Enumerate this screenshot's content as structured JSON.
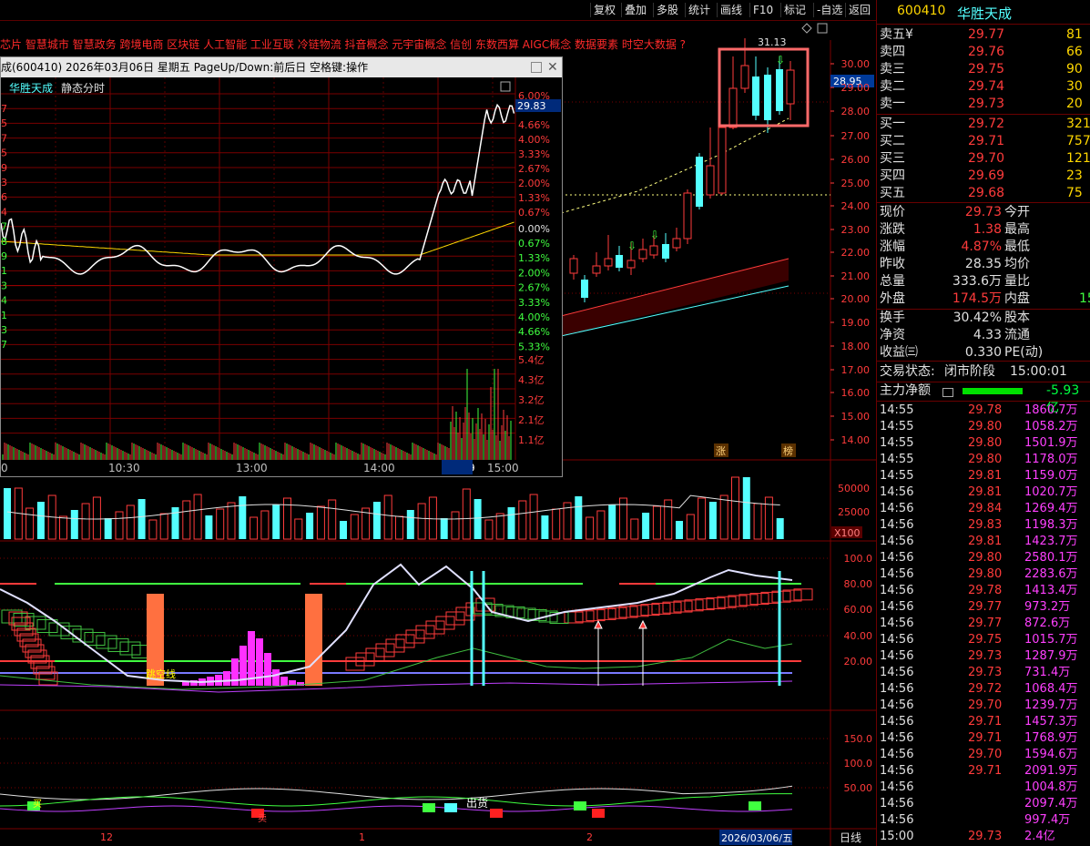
{
  "toolbar": {
    "buttons": [
      "复权",
      "叠加",
      "多股",
      "统计",
      "画线",
      "F10",
      "标记",
      "-自选",
      "返回"
    ]
  },
  "concepts_text": "芯片 智慧城市 智慧政务 跨境电商 区块链 人工智能 工业互联 冷链物流 抖音概念 元宇宙概念 信创 东数西算 AIGC概念 数据要素 时空大数据 ?",
  "main_chart": {
    "price_axis": [
      "30.00",
      "29.00",
      "28.00",
      "27.00",
      "26.00",
      "25.00",
      "24.00",
      "23.00",
      "22.00",
      "21.00",
      "20.00",
      "19.00",
      "18.00",
      "17.00",
      "16.00",
      "15.00",
      "14.00"
    ],
    "current_price_tag": "28.95",
    "high_label": "31.13",
    "zhang_label": "涨",
    "bang_label": "榜",
    "vol_axis": [
      "50000",
      "25000"
    ],
    "vol_unit": "X100",
    "kdj_axis": [
      "100.0",
      "80.00",
      "60.00",
      "40.00",
      "20.00"
    ],
    "bottom_axis": [
      "150.0",
      "100.0",
      "50.00"
    ],
    "x_labels": [
      "12",
      "1",
      "2"
    ],
    "date_label": "2026/03/06/五",
    "period_label": "日线",
    "annot_tiaoxian": "跳空线",
    "annot_chuhuo": "出货",
    "annot_mai": "买",
    "annot_mai2": "卖"
  },
  "popup": {
    "title": "成(600410) 2026年03月06日 星期五 PageUp/Down:前后日 空格键:操作",
    "stock_name": "华胜天成",
    "mode": "静态分时",
    "price_tag": "29.83",
    "pct_up": [
      "6.00%",
      "4.66%",
      "4.00%",
      "3.33%",
      "2.67%",
      "2.00%",
      "1.33%",
      "0.67%",
      "0.00%"
    ],
    "pct_down": [
      "0.67%",
      "1.33%",
      "2.00%",
      "2.67%",
      "3.33%",
      "4.00%",
      "4.66%",
      "5.33%"
    ],
    "vol_axis": [
      "5.4亿",
      "4.3亿",
      "3.2亿",
      "2.1亿",
      "1.1亿"
    ],
    "time_axis": [
      "0",
      "10:30",
      "13:00",
      "14:00",
      "14:39",
      "15:00"
    ],
    "left_digits": [
      "7",
      "5",
      "7",
      "5",
      "9",
      "3",
      "6",
      "4",
      "7",
      "8",
      "9",
      "1",
      "3",
      "4",
      "1",
      "3",
      "7"
    ]
  },
  "quote": {
    "code": "600410",
    "name": "华胜天成",
    "sell": [
      {
        "label": "卖五¥",
        "price": "29.77",
        "vol": "81"
      },
      {
        "label": "卖四",
        "price": "29.76",
        "vol": "66"
      },
      {
        "label": "卖三",
        "price": "29.75",
        "vol": "90"
      },
      {
        "label": "卖二",
        "price": "29.74",
        "vol": "30"
      },
      {
        "label": "卖一",
        "price": "29.73",
        "vol": "20"
      }
    ],
    "buy": [
      {
        "label": "买一",
        "price": "29.72",
        "vol": "321"
      },
      {
        "label": "买二",
        "price": "29.71",
        "vol": "757"
      },
      {
        "label": "买三",
        "price": "29.70",
        "vol": "121"
      },
      {
        "label": "买四",
        "price": "29.69",
        "vol": "23"
      },
      {
        "label": "买五",
        "price": "29.68",
        "vol": "75"
      }
    ],
    "stats": [
      {
        "l1": "现价",
        "v1": "29.73",
        "l2": "今开"
      },
      {
        "l1": "涨跌",
        "v1": "1.38",
        "l2": "最高"
      },
      {
        "l1": "涨幅",
        "v1": "4.87%",
        "l2": "最低"
      },
      {
        "l1": "昨收",
        "v1": "28.35",
        "l2": "均价"
      },
      {
        "l1": "总量",
        "v1": "333.6万",
        "l2": "量比"
      },
      {
        "l1": "外盘",
        "v1": "174.5万",
        "l2": "内盘",
        "v2": "15"
      }
    ],
    "stats2": [
      {
        "l1": "换手",
        "v1": "30.42%",
        "l2": "股本"
      },
      {
        "l1": "净资",
        "v1": "4.33",
        "l2": "流通"
      },
      {
        "l1": "收益㈢",
        "v1": "0.330",
        "l2": "PE(动)"
      }
    ],
    "trade_state_label": "交易状态:",
    "trade_state": "闭市阶段",
    "trade_time": "15:00:01",
    "main_net_label": "主力净额",
    "main_net_value": "-5.93亿"
  },
  "ticks": [
    {
      "t": "14:55",
      "p": "29.78",
      "v": "1860.7万"
    },
    {
      "t": "14:55",
      "p": "29.80",
      "v": "1058.2万"
    },
    {
      "t": "14:55",
      "p": "29.80",
      "v": "1501.9万"
    },
    {
      "t": "14:55",
      "p": "29.80",
      "v": "1178.0万"
    },
    {
      "t": "14:55",
      "p": "29.81",
      "v": "1159.0万"
    },
    {
      "t": "14:56",
      "p": "29.81",
      "v": "1020.7万"
    },
    {
      "t": "14:56",
      "p": "29.84",
      "v": "1269.4万"
    },
    {
      "t": "14:56",
      "p": "29.83",
      "v": "1198.3万"
    },
    {
      "t": "14:56",
      "p": "29.81",
      "v": "1423.7万"
    },
    {
      "t": "14:56",
      "p": "29.80",
      "v": "2580.1万"
    },
    {
      "t": "14:56",
      "p": "29.80",
      "v": "2283.6万"
    },
    {
      "t": "14:56",
      "p": "29.78",
      "v": "1413.4万"
    },
    {
      "t": "14:56",
      "p": "29.77",
      "v": "973.2万"
    },
    {
      "t": "14:56",
      "p": "29.77",
      "v": "872.6万"
    },
    {
      "t": "14:56",
      "p": "29.75",
      "v": "1015.7万"
    },
    {
      "t": "14:56",
      "p": "29.73",
      "v": "1287.9万"
    },
    {
      "t": "14:56",
      "p": "29.73",
      "v": "731.4万"
    },
    {
      "t": "14:56",
      "p": "29.72",
      "v": "1068.4万"
    },
    {
      "t": "14:56",
      "p": "29.70",
      "v": "1239.7万"
    },
    {
      "t": "14:56",
      "p": "29.71",
      "v": "1457.3万"
    },
    {
      "t": "14:56",
      "p": "29.71",
      "v": "1768.9万"
    },
    {
      "t": "14:56",
      "p": "29.70",
      "v": "1594.6万"
    },
    {
      "t": "14:56",
      "p": "29.71",
      "v": "2091.9万"
    },
    {
      "t": "14:56",
      "p": "",
      "v": "1004.8万"
    },
    {
      "t": "14:56",
      "p": "",
      "v": "2097.4万"
    },
    {
      "t": "14:56",
      "p": "",
      "v": "997.4万"
    },
    {
      "t": "15:00",
      "p": "29.73",
      "v": "2.4亿"
    }
  ],
  "colors": {
    "up": "#ff3b3b",
    "down": "#54ffff",
    "grid": "#7a0000",
    "yellow": "#ffff00",
    "magenta": "#ff40ff"
  }
}
